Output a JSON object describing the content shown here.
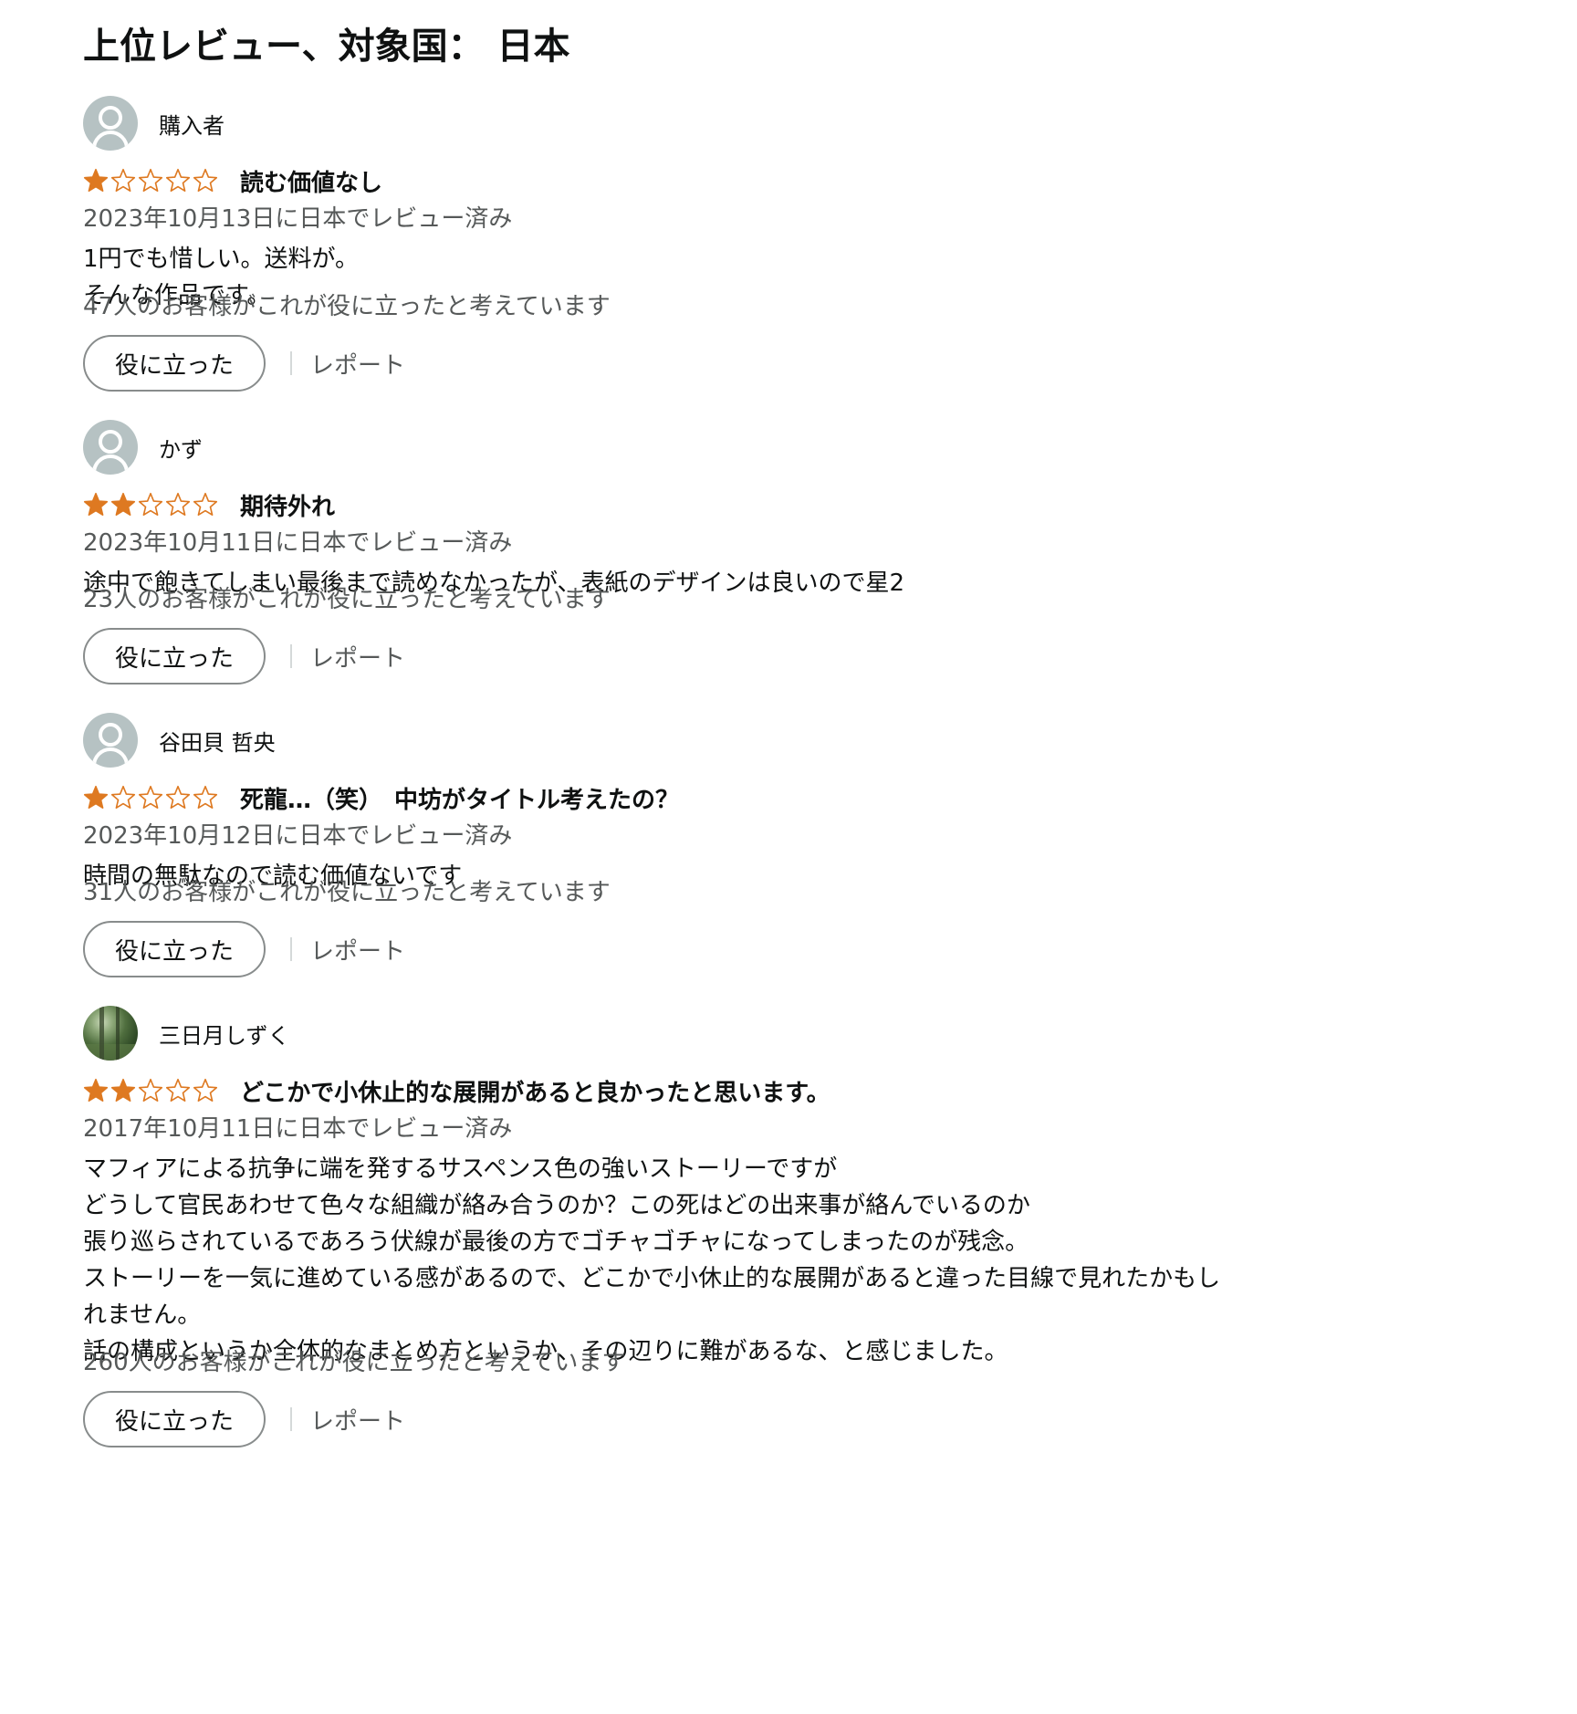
{
  "section": {
    "title": "上位レビュー、対象国： 日本"
  },
  "colors": {
    "star_fill": "#de7921",
    "text_primary": "#0f1111",
    "text_secondary": "#565959",
    "avatar_default": "#b6c2c3"
  },
  "reviews": [
    {
      "profile_name": "購入者",
      "rating": 1,
      "rating_max": 5,
      "title": "読む価値なし",
      "date": "2023年10月13日に日本でレビュー済み",
      "body": [
        "1円でも惜しい。送料が。",
        "そんな作品です。"
      ],
      "helpful_count": "47人のお客様がこれが役に立ったと考えています",
      "helpful_label": "役に立った",
      "report_label": "レポート",
      "avatar": "default-user-icon"
    },
    {
      "profile_name": "かず",
      "rating": 2,
      "rating_max": 5,
      "title": "期待外れ",
      "date": "2023年10月11日に日本でレビュー済み",
      "body": [
        "途中で飽きてしまい最後まで読めなかったが、表紙のデザインは良いので星2"
      ],
      "helpful_count": "23人のお客様がこれが役に立ったと考えています",
      "helpful_label": "役に立った",
      "report_label": "レポート",
      "avatar": "default-user-icon"
    },
    {
      "profile_name": "谷田貝 哲央",
      "rating": 1,
      "rating_max": 5,
      "title": "死龍…（笑）　中坊がタイトル考えたの？",
      "date": "2023年10月12日に日本でレビュー済み",
      "body": [
        "時間の無駄なので読む価値ないです"
      ],
      "helpful_count": "31人のお客様がこれが役に立ったと考えています",
      "helpful_label": "役に立った",
      "report_label": "レポート",
      "avatar": "default-user-icon"
    },
    {
      "profile_name": "三日月しずく",
      "rating": 2,
      "rating_max": 5,
      "title": "どこかで小休止的な展開があると良かったと思います。",
      "date": "2017年10月11日に日本でレビュー済み",
      "body": [
        "マフィアによる抗争に端を発するサスペンス色の強いストーリーですが",
        "どうして官民あわせて色々な組織が絡み合うのか？この死はどの出来事が絡んでいるのか",
        "張り巡らされているであろう伏線が最後の方でゴチャゴチャになってしまったのが残念。",
        "ストーリーを一気に進めている感があるので、どこかで小休止的な展開があると違った目線で見れたかもし",
        "れません。",
        "話の構成というか全体的なまとめ方というか、その辺りに難があるな、と感じました。"
      ],
      "helpful_count": "260人のお客様がこれが役に立ったと考えています",
      "helpful_label": "役に立った",
      "report_label": "レポート",
      "avatar": "forest-photo-avatar"
    }
  ]
}
